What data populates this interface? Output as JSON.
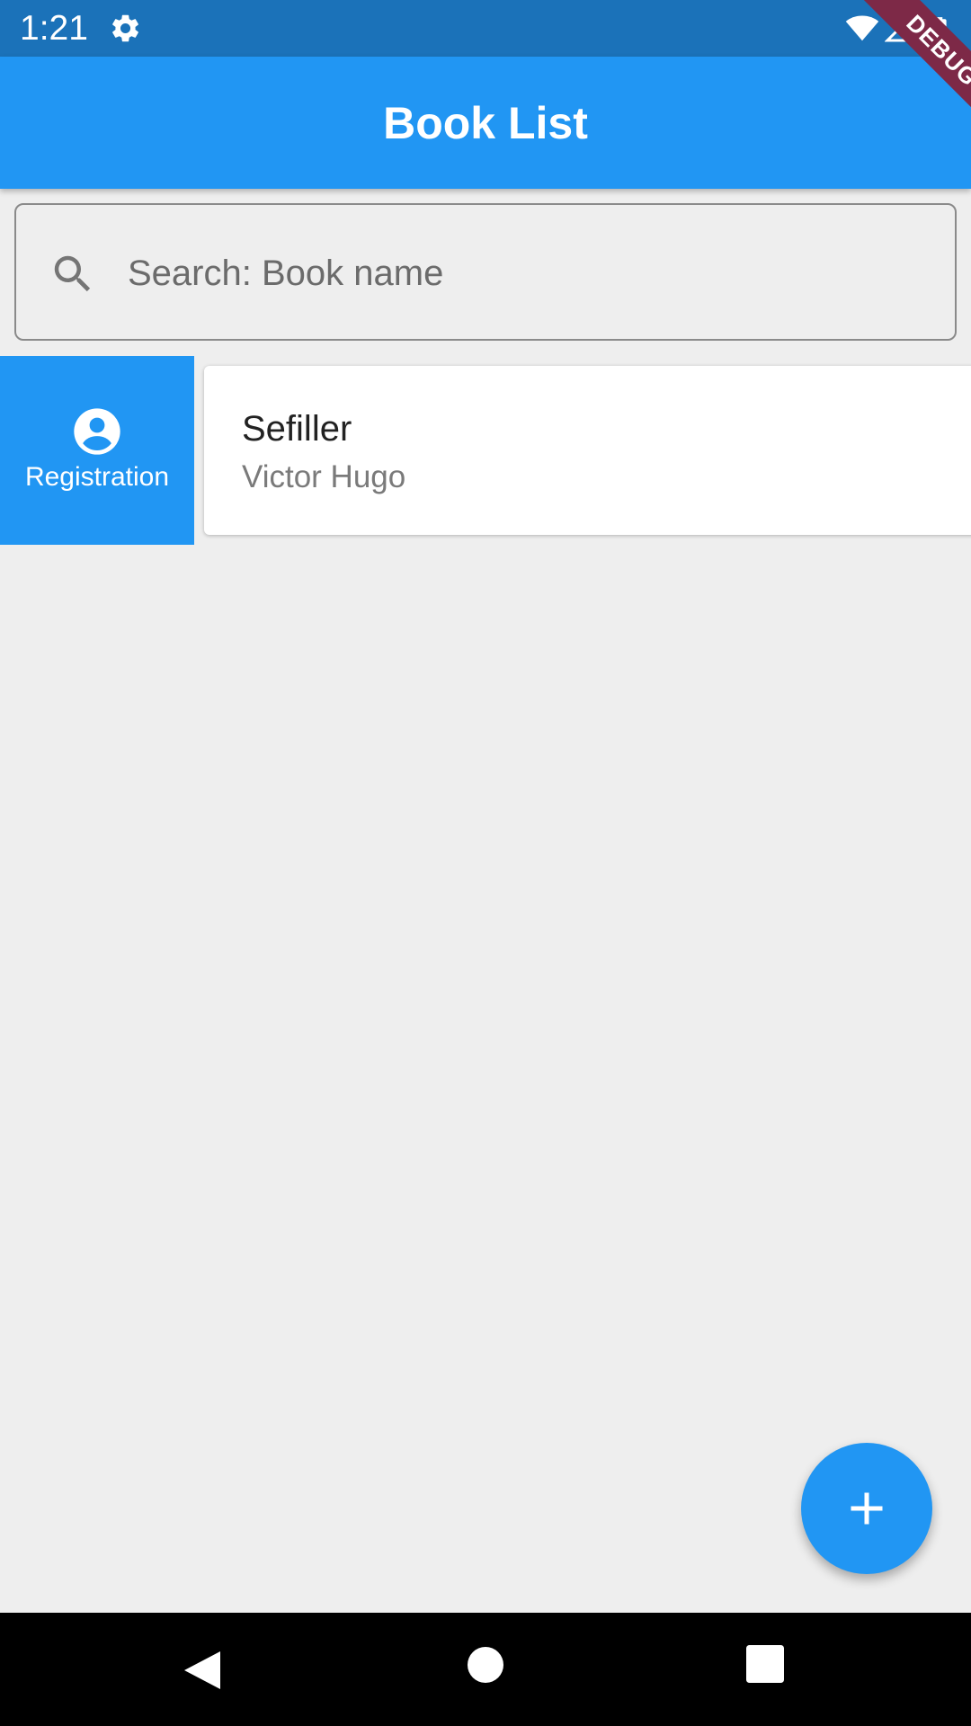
{
  "status_bar": {
    "time": "1:21",
    "icons": [
      "gear-icon",
      "wifi-icon",
      "signal-icon",
      "battery-icon"
    ]
  },
  "debug_banner": {
    "label": "DEBUG",
    "color": "#7d2947"
  },
  "app_bar": {
    "title": "Book List",
    "color": "#2196f3"
  },
  "search": {
    "placeholder": "Search: Book name",
    "value": ""
  },
  "slide_action": {
    "label": "Registration",
    "icon": "account-circle-icon"
  },
  "books": [
    {
      "title": "Sefiller",
      "author": "Victor Hugo"
    }
  ],
  "fab": {
    "icon": "add-icon"
  },
  "nav_bar": {
    "buttons": [
      "back-icon",
      "home-icon",
      "recents-icon"
    ]
  }
}
